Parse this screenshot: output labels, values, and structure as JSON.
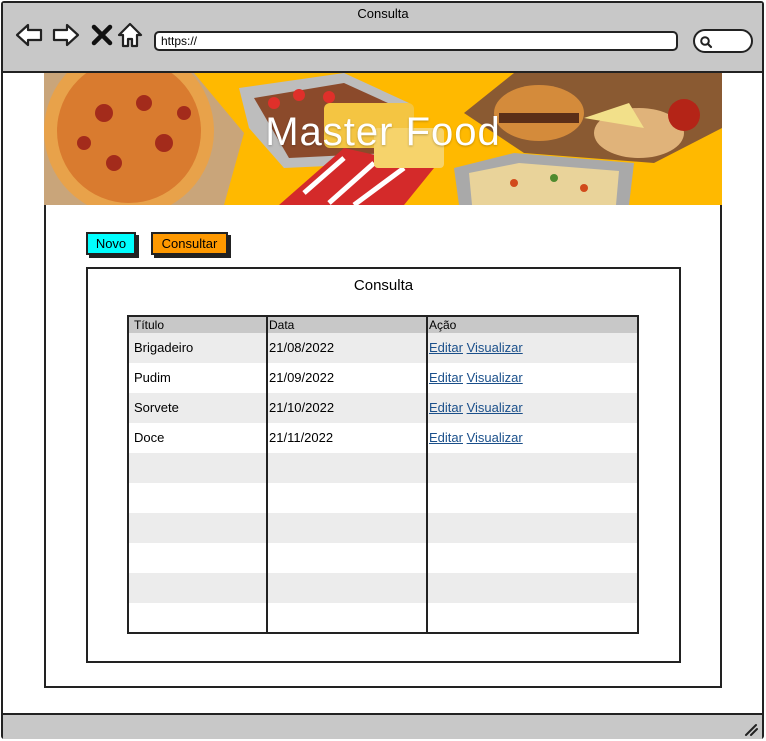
{
  "window": {
    "title": "Consulta"
  },
  "browser": {
    "url": "https://"
  },
  "banner": {
    "title": "Master Food"
  },
  "buttons": {
    "novo": {
      "label": "Novo",
      "color": "#00ffff"
    },
    "consultar": {
      "label": "Consultar",
      "color": "#ff9900"
    }
  },
  "panel": {
    "title": "Consulta"
  },
  "table": {
    "headers": [
      "Título",
      "Data",
      "Ação"
    ],
    "rows": [
      {
        "titulo": "Brigadeiro",
        "data": "21/08/2022",
        "editar": "Editar",
        "visualizar": "Visualizar"
      },
      {
        "titulo": "Pudim",
        "data": "21/09/2022",
        "editar": "Editar",
        "visualizar": "Visualizar"
      },
      {
        "titulo": "Sorvete",
        "data": "21/10/2022",
        "editar": "Editar",
        "visualizar": "Visualizar"
      },
      {
        "titulo": "Doce",
        "data": "21/11/2022",
        "editar": "Editar",
        "visualizar": "Visualizar"
      }
    ]
  }
}
